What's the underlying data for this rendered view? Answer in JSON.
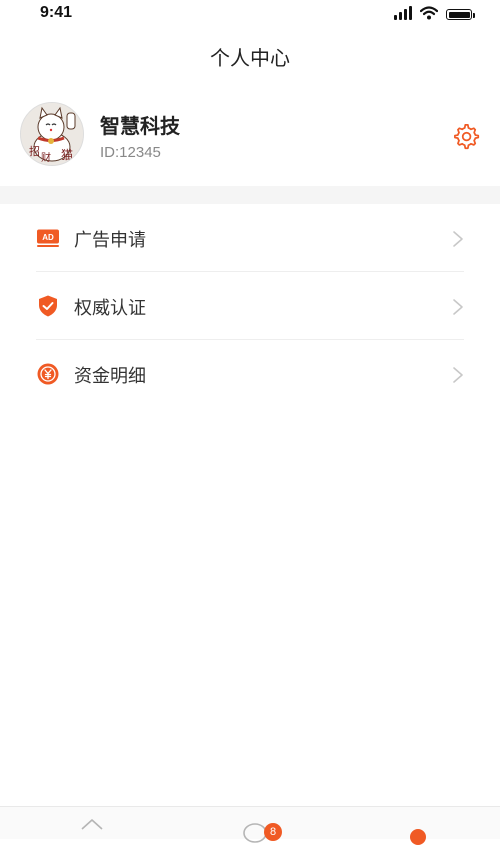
{
  "status_bar": {
    "time": "9:41"
  },
  "header": {
    "title": "个人中心"
  },
  "profile": {
    "name": "智慧科技",
    "id_text": "ID:12345",
    "avatar_icon": "lucky-cat-avatar-icon"
  },
  "menu": {
    "items": [
      {
        "label": "广告申请",
        "icon": "ad-icon"
      },
      {
        "label": "权威认证",
        "icon": "shield-check-icon"
      },
      {
        "label": "资金明细",
        "icon": "yuan-coin-icon"
      }
    ]
  },
  "tab_bar": {
    "message_badge": "8"
  },
  "colors": {
    "accent": "#f05a24",
    "divider": "#f5f5f5",
    "chevron": "#c8c8c8"
  }
}
